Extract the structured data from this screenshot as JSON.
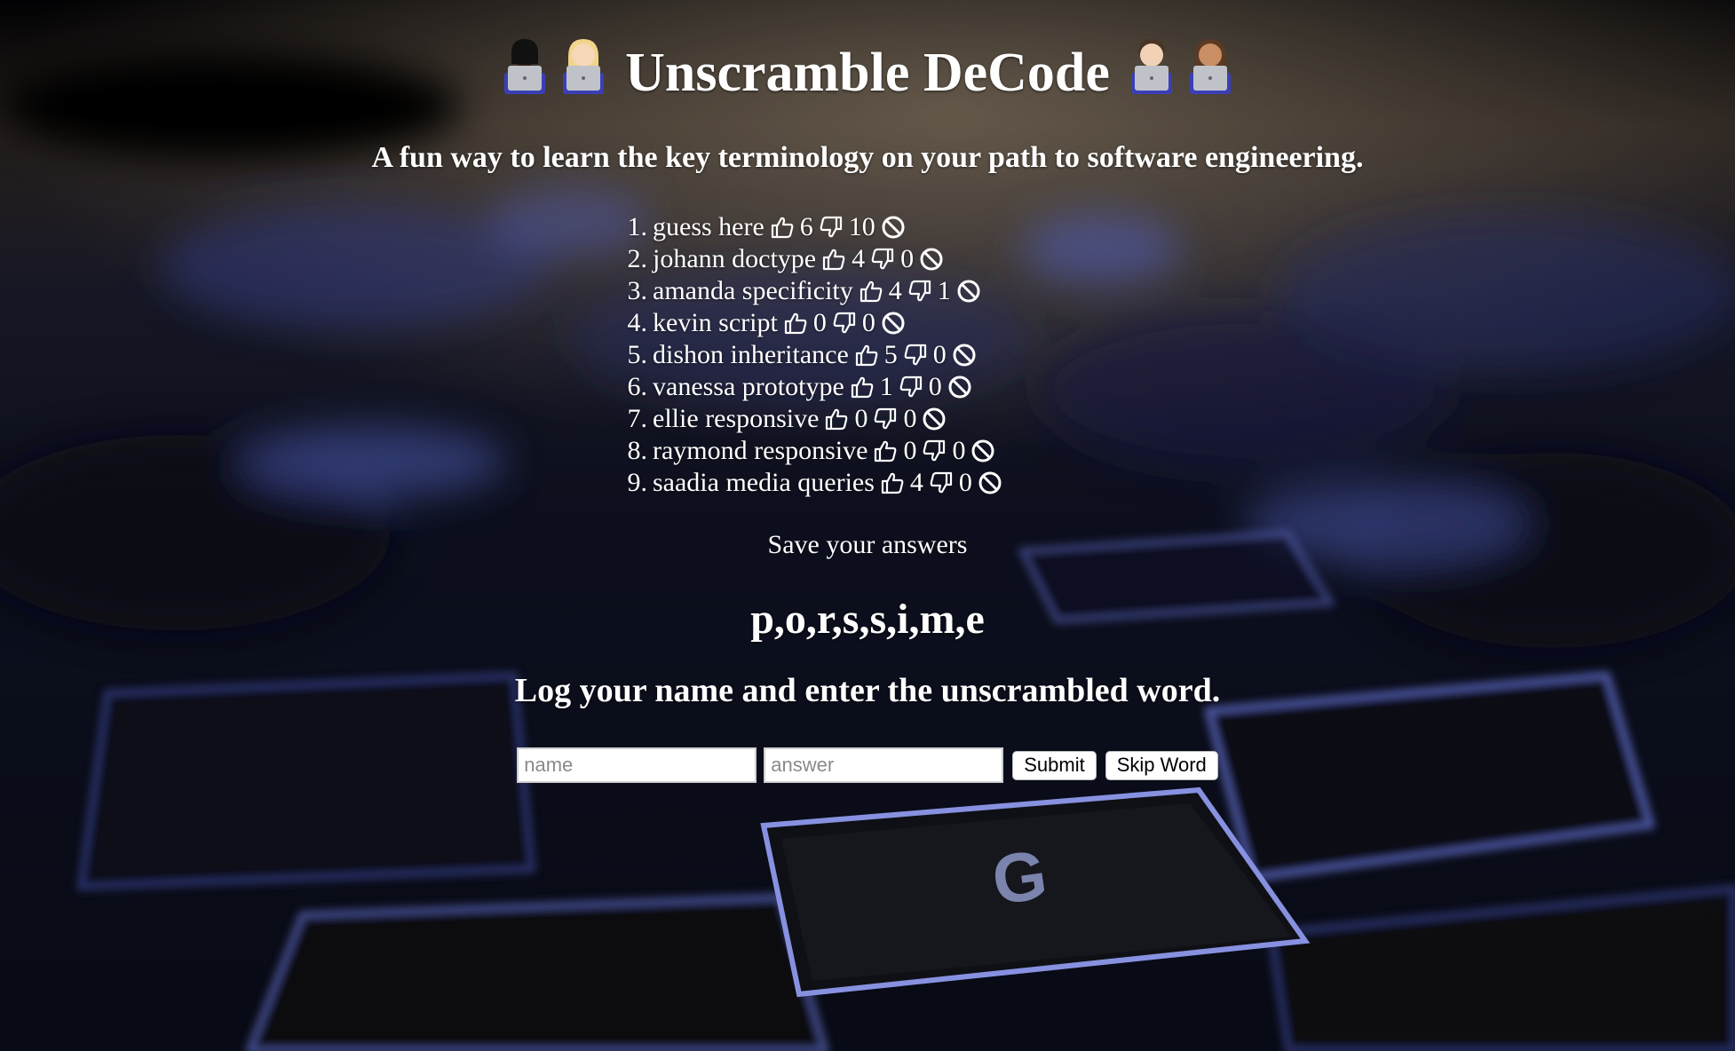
{
  "page": {
    "title": "Unscramble DeCode",
    "subtitle": "A fun way to learn the key terminology on your path to software engineering.",
    "title_emoji_left": [
      "technologist-dark-skin",
      "technologist-light-skin"
    ],
    "title_emoji_right": [
      "technologist-light-skin",
      "technologist-medium-skin"
    ]
  },
  "leaderboard": [
    {
      "num": "1.",
      "name": "guess here",
      "likes": "6",
      "dislikes": "10"
    },
    {
      "num": "2.",
      "name": "johann doctype",
      "likes": "4",
      "dislikes": "0"
    },
    {
      "num": "3.",
      "name": "amanda specificity",
      "likes": "4",
      "dislikes": "1"
    },
    {
      "num": "4.",
      "name": "kevin script",
      "likes": "0",
      "dislikes": "0"
    },
    {
      "num": "5.",
      "name": "dishon inheritance",
      "likes": "5",
      "dislikes": "0"
    },
    {
      "num": "6.",
      "name": "vanessa prototype",
      "likes": "1",
      "dislikes": "0"
    },
    {
      "num": "7.",
      "name": "ellie responsive",
      "likes": "0",
      "dislikes": "0"
    },
    {
      "num": "8.",
      "name": "raymond responsive",
      "likes": "0",
      "dislikes": "0"
    },
    {
      "num": "9.",
      "name": "saadia media queries",
      "likes": "4",
      "dislikes": "0"
    }
  ],
  "save_label": "Save your answers",
  "scrambled_word": "p,o,r,s,s,i,m,e",
  "instructions": "Log your name and enter the unscrambled word.",
  "form": {
    "name_placeholder": "name",
    "answer_placeholder": "answer",
    "submit_label": "Submit",
    "skip_label": "Skip Word"
  },
  "icons": {
    "like": "thumbs-up-icon",
    "dislike": "thumbs-down-icon",
    "delete": "ban-icon"
  },
  "colors": {
    "text": "#ffffff",
    "key_glow": "#5a6fd8"
  }
}
